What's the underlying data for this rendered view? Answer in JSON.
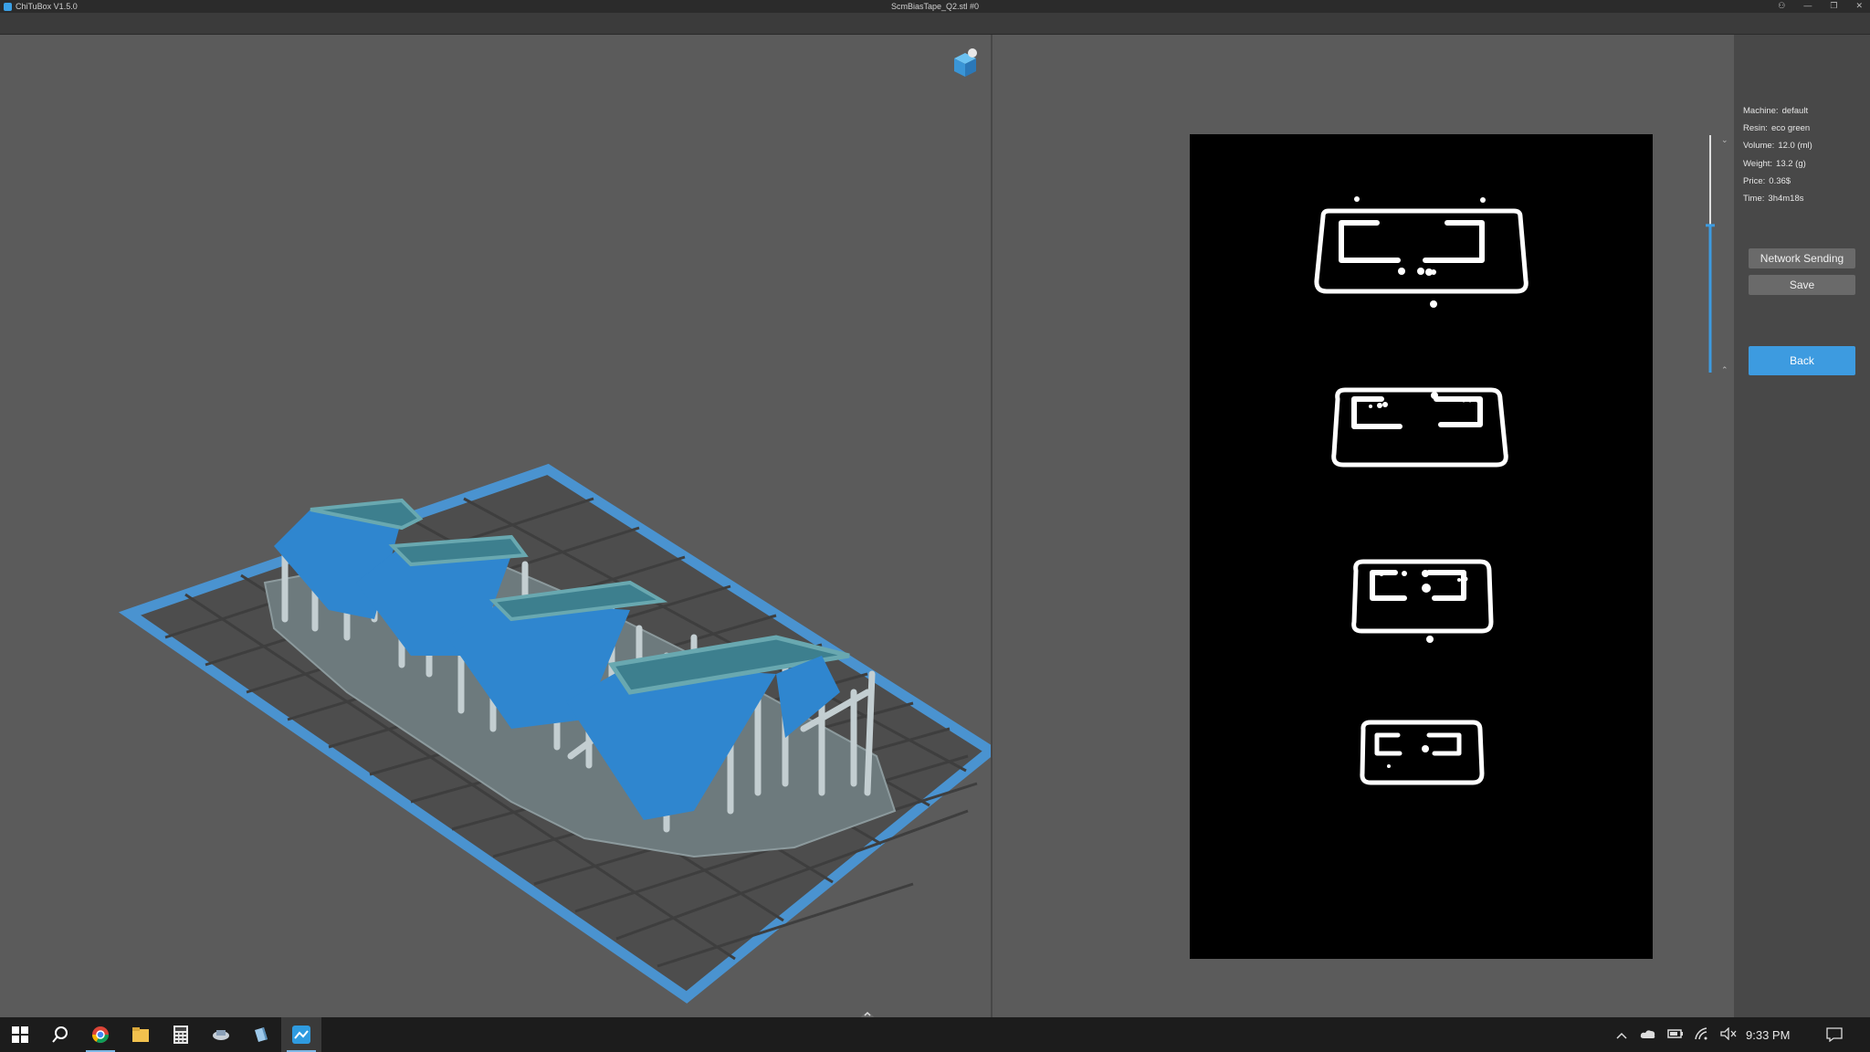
{
  "window": {
    "app_title": "ChiTuBox V1.5.0",
    "doc_title": "ScmBiasTape_Q2.stl #0",
    "controls": [
      "⚇",
      "—",
      "❐",
      "✕"
    ]
  },
  "info": {
    "machine_label": "Machine:",
    "machine_value": "default",
    "resin_label": "Resin:",
    "resin_value": "eco green",
    "volume_label": "Volume:",
    "volume_value": "12.0  (ml)",
    "weight_label": "Weight:",
    "weight_value": "13.2  (g)",
    "price_label": "Price:",
    "price_value": "0.36$",
    "time_label": "Time:",
    "time_value": "3h4m18s"
  },
  "buttons": {
    "network_sending": "Network Sending",
    "save": "Save",
    "back": "Back"
  },
  "layer_slider": {
    "position": 0.38
  },
  "colors": {
    "accent_blue": "#3d9be0",
    "model_blue": "#2f86cf",
    "plate_blue": "#4a93d0",
    "support_gray": "#b8c4c8"
  },
  "taskbar": {
    "icons": [
      "windows-start-icon",
      "search-icon",
      "chrome-icon",
      "file-explorer-icon",
      "calculator-icon",
      "slicer-app-icon",
      "3d-viewer-icon",
      "chitubox-icon"
    ],
    "clock": "9:33 PM"
  }
}
